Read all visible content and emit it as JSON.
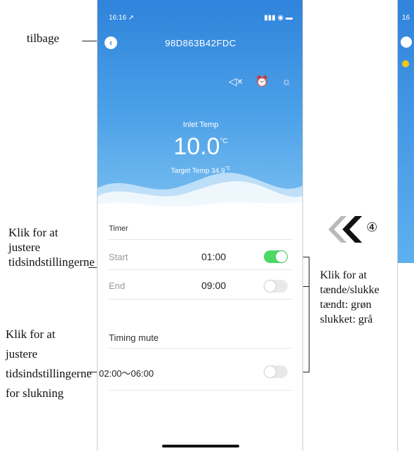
{
  "phone": {
    "status_time": "16:16 ➚",
    "status_icons": "▮▮▮ ◉ ▬",
    "device_id": "98D863B42FDC",
    "inlet_label": "Inlet Temp",
    "inlet_value": "10.0",
    "inlet_unit": "°C",
    "target_label": "Target Temp",
    "target_value": "34.9",
    "target_unit": "°C",
    "timer_section": "Timer",
    "start_label": "Start",
    "start_value": "01:00",
    "start_enabled": true,
    "end_label": "End",
    "end_value": "09:00",
    "end_enabled": false,
    "mute_section": "Timing mute",
    "mute_range": "02:00～06:00",
    "mute_enabled": false,
    "icons": [
      "mute-icon",
      "alarm-clock-icon",
      "brightness-icon",
      "back-icon"
    ]
  },
  "annotations": {
    "back": "tilbage",
    "adjust_timer": "Klik for at justere tidsindstillingerne",
    "adjust_mute": "Klik for at justere tidsindstillingerne for slukning",
    "toggle_help_1": "Klik for at tænde/slukke",
    "toggle_help_2": "tændt: grøn",
    "toggle_help_3": "slukket: grå",
    "step_marker": "④"
  },
  "side_phone": {
    "status_time": "16"
  },
  "colors": {
    "hero_blue": "#2f83db",
    "toggle_on": "#4cd964",
    "toggle_off": "#e9e9ea"
  }
}
